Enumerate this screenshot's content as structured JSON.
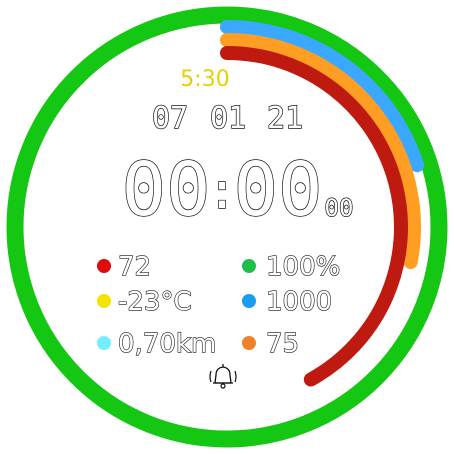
{
  "colors": {
    "outer_ring": "#13c713",
    "ring_blue": "#3aa8ff",
    "ring_orange": "#ff9e22",
    "ring_red": "#be1a10",
    "small_time": "#e8d000",
    "dot_red": "#e00a0a",
    "dot_green": "#1fbe4a",
    "dot_yellow": "#f2e400",
    "dot_blue": "#1c9cf0",
    "dot_cyan": "#76ecff",
    "dot_orange": "#f0812c"
  },
  "progress": {
    "blue_fraction": 0.2,
    "orange_fraction": 0.28,
    "red_fraction": 0.42
  },
  "watch": {
    "small_time": "5:30",
    "date_day": "07",
    "date_month": "01",
    "date_year": "21",
    "hours": "00",
    "colon": ":",
    "minutes": "00",
    "seconds": "00"
  },
  "stats": {
    "heart_rate": "72",
    "battery": "100%",
    "temperature": "-23°C",
    "steps": "1000",
    "distance": "0,70km",
    "calories": "75"
  },
  "icons": {
    "alarm": "bell-icon"
  }
}
